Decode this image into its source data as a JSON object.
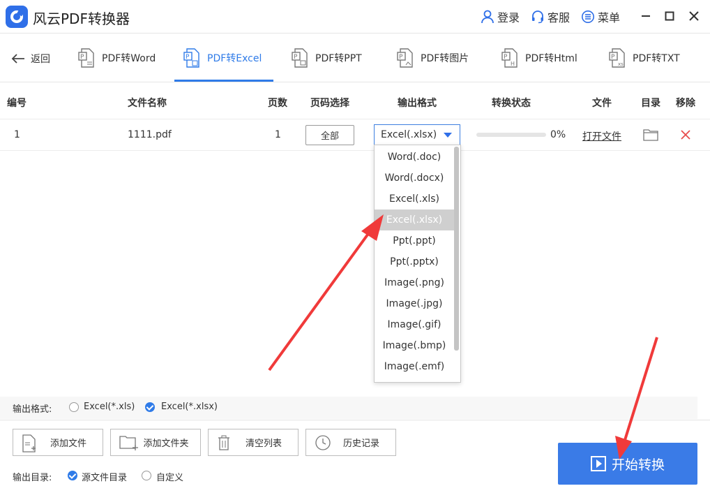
{
  "app": {
    "title": "风云PDF转换器"
  },
  "titlebar": {
    "login": "登录",
    "service": "客服",
    "menu": "菜单"
  },
  "nav": {
    "back": "返回",
    "tabs": [
      {
        "label": "PDF转Word"
      },
      {
        "label": "PDF转Excel",
        "active": true
      },
      {
        "label": "PDF转PPT"
      },
      {
        "label": "PDF转图片"
      },
      {
        "label": "PDF转Html"
      },
      {
        "label": "PDF转TXT"
      }
    ]
  },
  "table": {
    "headers": {
      "index": "编号",
      "name": "文件名称",
      "pages": "页数",
      "page_select": "页码选择",
      "format": "输出格式",
      "status": "转换状态",
      "file": "文件",
      "dir": "目录",
      "remove": "移除"
    },
    "rows": [
      {
        "index": "1",
        "name": "1111.pdf",
        "pages": "1",
        "page_select": "全部",
        "format": "Excel(.xlsx)",
        "progress": "0%",
        "progress_value": 0,
        "open": "打开文件"
      }
    ]
  },
  "dropdown": {
    "options": [
      "Word(.doc)",
      "Word(.docx)",
      "Excel(.xls)",
      "Excel(.xlsx)",
      "Ppt(.ppt)",
      "Ppt(.pptx)",
      "Image(.png)",
      "Image(.jpg)",
      "Image(.gif)",
      "Image(.bmp)",
      "Image(.emf)"
    ],
    "selected_index": 3
  },
  "output_format": {
    "label": "输出格式:",
    "opt1": "Excel(*.xls)",
    "opt2": "Excel(*.xlsx)",
    "selected": "Excel(*.xlsx)"
  },
  "actions": {
    "add_file": "添加文件",
    "add_folder": "添加文件夹",
    "clear": "清空列表",
    "history": "历史记录"
  },
  "output_dir": {
    "label": "输出目录:",
    "opt1": "源文件目录",
    "opt2": "自定义",
    "selected": "源文件目录"
  },
  "start": {
    "label": "开始转换"
  },
  "colors": {
    "accent": "#3a7be7",
    "arrow": "#f03a3a",
    "remove": "#e84c4c"
  }
}
